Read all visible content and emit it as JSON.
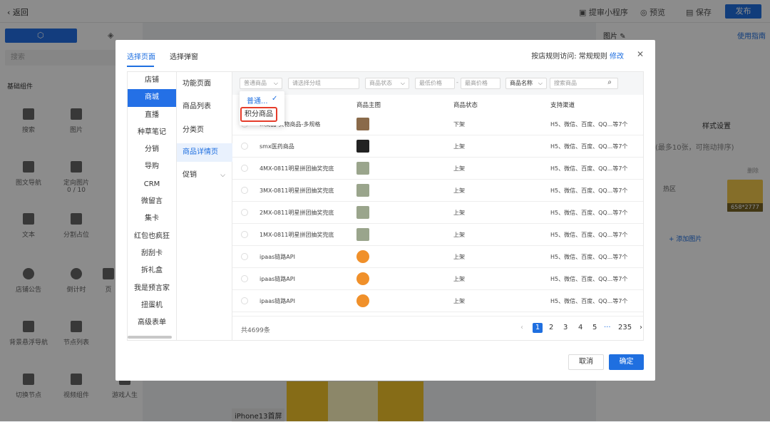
{
  "topbar": {
    "back_label": "返回",
    "review_label": "提审小程序",
    "preview_label": "预览",
    "save_label": "保存",
    "publish_label": "发布"
  },
  "left_panel": {
    "search_placeholder": "搜索",
    "section_title": "基础组件",
    "components": [
      {
        "label": "搜索",
        "icon": "search-icon"
      },
      {
        "label": "图片",
        "icon": "image-icon"
      },
      {
        "label": "图文导航",
        "icon": "grid-nav-icon"
      },
      {
        "label": "定向图片",
        "icon": "image-add-icon",
        "count": "0 / 10"
      },
      {
        "label": "文本",
        "icon": "text-icon"
      },
      {
        "label": "分割占位",
        "icon": "divider-icon"
      },
      {
        "label": "店铺公告",
        "icon": "speaker-icon"
      },
      {
        "label": "倒计时",
        "icon": "clock-icon"
      },
      {
        "label": "页",
        "icon": "page-icon"
      },
      {
        "label": "背景悬浮导航",
        "icon": "float-nav-icon"
      },
      {
        "label": "节点列表",
        "icon": "node-list-icon"
      },
      {
        "label": "切换节点",
        "icon": "switch-node-icon"
      },
      {
        "label": "视频组件",
        "icon": "video-icon"
      },
      {
        "label": "游戏人生",
        "icon": "game-icon"
      }
    ]
  },
  "canvas": {
    "page_label": "iPhone13首屏"
  },
  "right_panel": {
    "title": "图片",
    "guide_link": "使用指南",
    "style_settings": "样式设置",
    "max_hint": "(最多10张，可拖动排序)",
    "hot_zone": "热区",
    "image_size": "658*2777",
    "add_image": "+ 添加图片",
    "delete_label": "删除"
  },
  "modal": {
    "tabs": [
      "选择页面",
      "选择弹窗"
    ],
    "rule_text": "按店规则访问: 常规规则",
    "rule_edit": "修改",
    "categories": [
      "店铺",
      "商城",
      "直播",
      "种草笔记",
      "分销",
      "导购",
      "CRM",
      "微留言",
      "集卡",
      "红包也疯狂",
      "刮刮卡",
      "拆礼盒",
      "我是预言家",
      "扭蛋机",
      "高级表单"
    ],
    "active_category": 1,
    "subcategories": [
      "功能页面",
      "商品列表",
      "分类页",
      "商品详情页",
      "促销"
    ],
    "filters": {
      "product_type": "普通商品",
      "group_placeholder": "请选择分组",
      "status_placeholder": "商品状态",
      "min_price": "最低价格",
      "max_price": "最高价格",
      "name_select": "商品名称",
      "search_placeholder": "搜索商品"
    },
    "dropdown": {
      "option1": "普通...",
      "option2": "积分商品"
    },
    "columns": [
      "商品主图",
      "商品状态",
      "支持渠道"
    ],
    "rows": [
      {
        "name": "...商品-实物商品-多规格",
        "status": "下架",
        "channels": "H5、微信、百度、QQ...等7个",
        "thumb": "thumb-landscape"
      },
      {
        "name": "smx医药商品",
        "status": "上架",
        "channels": "H5、微信、百度、QQ...等7个",
        "thumb": "thumb-car"
      },
      {
        "name": "4MX-0811明星拼团抽奖兜底",
        "status": "上架",
        "channels": "H5、微信、百度、QQ...等7个",
        "thumb": "thumb-person"
      },
      {
        "name": "3MX-0811明星拼团抽奖兜底",
        "status": "上架",
        "channels": "H5、微信、百度、QQ...等7个",
        "thumb": "thumb-person"
      },
      {
        "name": "2MX-0811明星拼团抽奖兜底",
        "status": "上架",
        "channels": "H5、微信、百度、QQ...等7个",
        "thumb": "thumb-person"
      },
      {
        "name": "1MX-0811明星拼团抽奖兜底",
        "status": "上架",
        "channels": "H5、微信、百度、QQ...等7个",
        "thumb": "thumb-person"
      },
      {
        "name": "ipaas链路API",
        "status": "上架",
        "channels": "H5、微信、百度、QQ...等7个",
        "thumb": "thumb-orange"
      },
      {
        "name": "ipaas链路API",
        "status": "上架",
        "channels": "H5、微信、百度、QQ...等7个",
        "thumb": "thumb-orange"
      },
      {
        "name": "ipaas链路API",
        "status": "上架",
        "channels": "H5、微信、百度、QQ...等7个",
        "thumb": "thumb-orange"
      }
    ],
    "total": "共4699条",
    "pages": [
      "1",
      "2",
      "3",
      "4",
      "5",
      "···",
      "235"
    ],
    "current_page": "1",
    "cancel_label": "取消",
    "ok_label": "确定"
  },
  "colors": {
    "accent": "#1f6fe0",
    "highlight": "#e53c2a"
  }
}
